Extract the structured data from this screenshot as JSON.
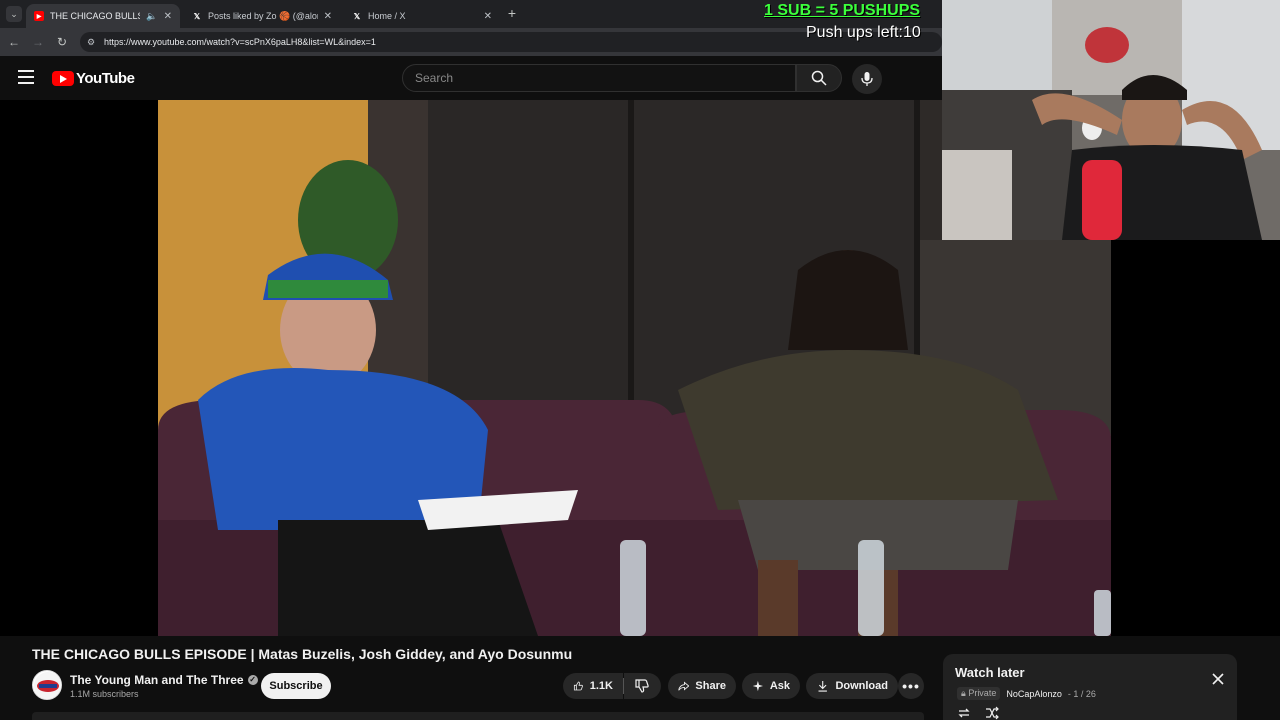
{
  "browser": {
    "tabs": [
      {
        "title": "THE CHICAGO BULLS EPISO",
        "active": true,
        "icon": "youtube-icon"
      },
      {
        "title": "Posts liked by Zo 🏀 (@alonzo",
        "active": false,
        "icon": "x-icon"
      },
      {
        "title": "Home / X",
        "active": false,
        "icon": "x-icon"
      }
    ],
    "new_tab": "+",
    "url": "https://www.youtube.com/watch?v=scPnX6paLH8&list=WL&index=1"
  },
  "overlay": {
    "sub_banner": "1 SUB = 5 PUSHUPS",
    "pushups_left": "Push ups left:10",
    "banner_color": "#3cff3c"
  },
  "header": {
    "logo_text": "YouTube",
    "search_placeholder": "Search"
  },
  "video": {
    "title": "THE CHICAGO BULLS EPISODE | Matas Buzelis, Josh Giddey, and Ayo Dosunmu"
  },
  "channel": {
    "name": "The Young Man and The Three",
    "subscribers": "1.1M subscribers",
    "verified": true,
    "subscribe_label": "Subscribe"
  },
  "actions": {
    "likes": "1.1K",
    "share": "Share",
    "ask": "Ask",
    "download": "Download"
  },
  "playlist": {
    "title": "Watch later",
    "privacy": "Private",
    "owner": "NoCapAlonzo",
    "position": "- 1 / 26"
  },
  "colors": {
    "youtube_red": "#ff0000",
    "background": "#0f0f0f",
    "panel": "#212121"
  }
}
